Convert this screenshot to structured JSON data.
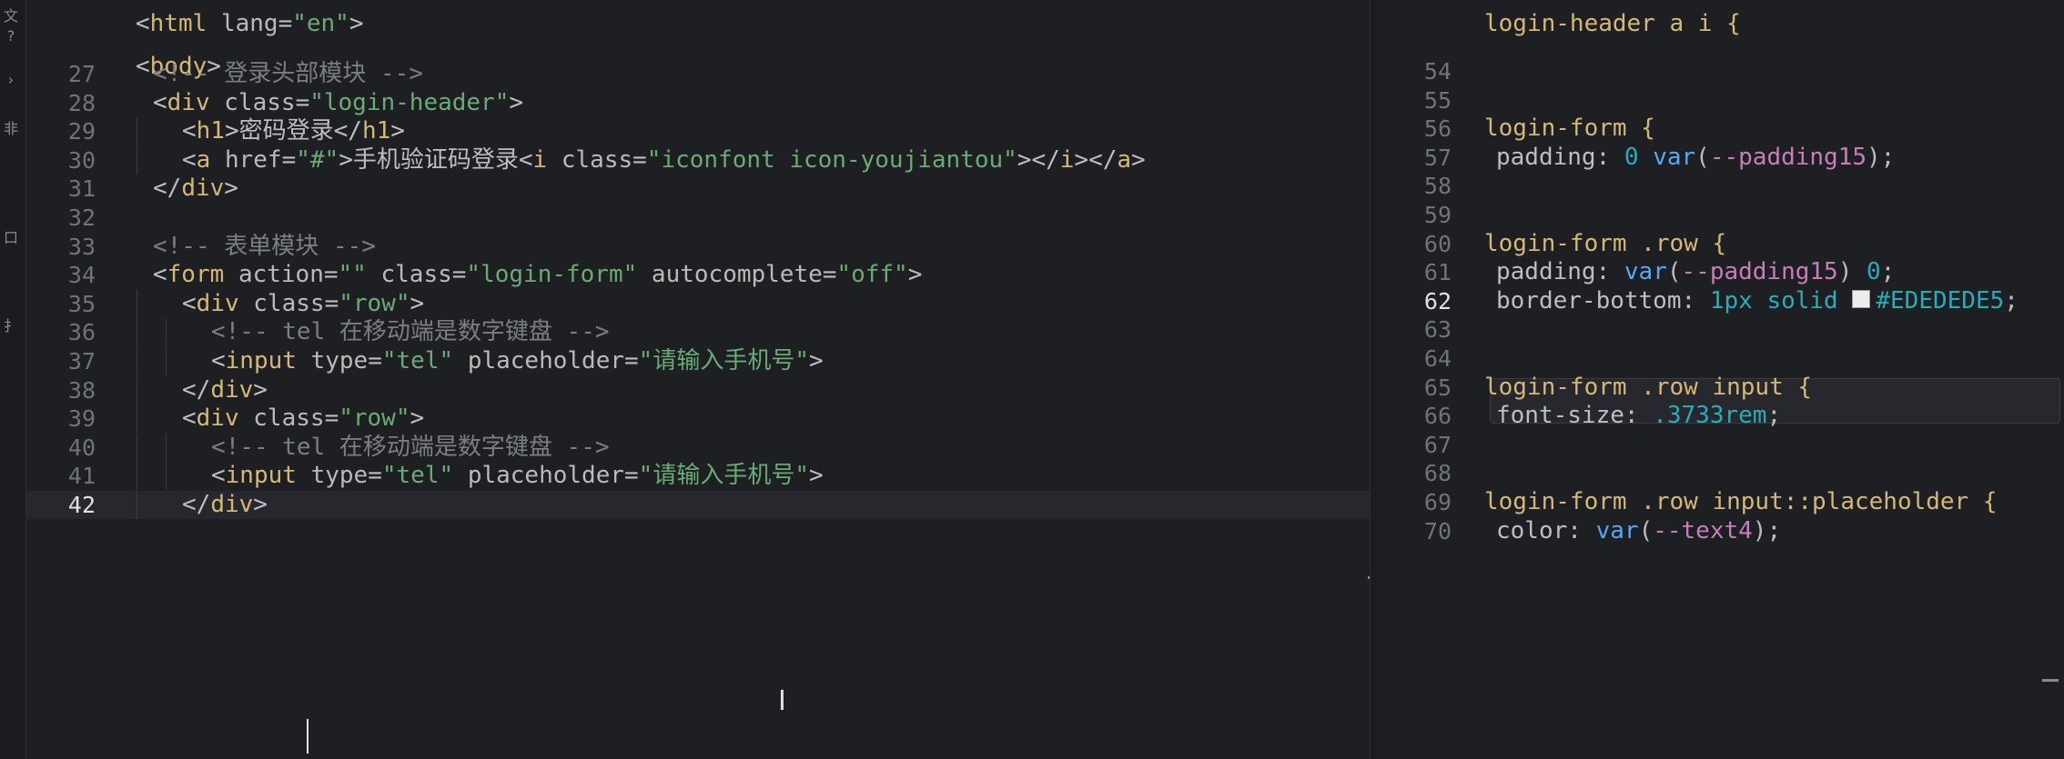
{
  "activity_bar": {
    "icons": [
      {
        "name": "explorer-icon",
        "glyph": "文"
      },
      {
        "name": "search-icon",
        "glyph": "?"
      },
      {
        "name": "arrow-right-icon",
        "glyph": "›"
      },
      {
        "name": "source-control-icon",
        "glyph": "⾮"
      },
      {
        "name": "debug-icon",
        "glyph": "⼝"
      },
      {
        "name": "extensions-icon",
        "glyph": "⺘"
      }
    ]
  },
  "left_editor": {
    "header_lines": [
      {
        "text": "<html lang=\"en\">"
      },
      {
        "text": "<body>"
      }
    ],
    "lines": [
      {
        "number": "27",
        "text": "<!-- 登录头部模块 -->"
      },
      {
        "number": "28",
        "text": "<div class=\"login-header\">"
      },
      {
        "number": "29",
        "text": "<h1>密码登录</h1>"
      },
      {
        "number": "30",
        "text": "<a href=\"#\">手机验证码登录<i class=\"iconfont icon-youjiantou\"></i></a>"
      },
      {
        "number": "31",
        "text": "</div>"
      },
      {
        "number": "32",
        "text": ""
      },
      {
        "number": "33",
        "text": "<!-- 表单模块 -->"
      },
      {
        "number": "34",
        "text": "<form action=\"\" class=\"login-form\" autocomplete=\"off\">"
      },
      {
        "number": "35",
        "text": "<div class=\"row\">"
      },
      {
        "number": "36",
        "text": "<!-- tel 在移动端是数字键盘 -->"
      },
      {
        "number": "37",
        "text": "<input type=\"tel\" placeholder=\"请输入手机号\">"
      },
      {
        "number": "38",
        "text": "</div>"
      },
      {
        "number": "39",
        "text": "<div class=\"row\">"
      },
      {
        "number": "40",
        "text": "<!-- tel 在移动端是数字键盘 -->"
      },
      {
        "number": "41",
        "text": "<input type=\"tel\" placeholder=\"请输入手机号\">"
      },
      {
        "number": "42",
        "text": "</div>"
      }
    ]
  },
  "right_editor": {
    "header_line": "login-header a i {",
    "lines": [
      {
        "number": "54",
        "text": ""
      },
      {
        "number": "55",
        "text": ""
      },
      {
        "number": "56",
        "text": "login-form {"
      },
      {
        "number": "57",
        "text": "padding: 0 var(--padding15);"
      },
      {
        "number": "58",
        "text": ""
      },
      {
        "number": "59",
        "text": ""
      },
      {
        "number": "60",
        "text": "login-form .row {"
      },
      {
        "number": "61",
        "text": "padding: var(--padding15) 0;"
      },
      {
        "number": "62",
        "text": "border-bottom: 1px solid #EDEDEDE5;"
      },
      {
        "number": "63",
        "text": ""
      },
      {
        "number": "64",
        "text": ""
      },
      {
        "number": "65",
        "text": "login-form .row input {"
      },
      {
        "number": "66",
        "text": "font-size: .3733rem;"
      },
      {
        "number": "67",
        "text": ""
      },
      {
        "number": "68",
        "text": ""
      },
      {
        "number": "69",
        "text": "login-form .row input::placeholder {"
      },
      {
        "number": "70",
        "text": "color: var(--text4);"
      }
    ]
  },
  "colors": {
    "background": "#1e1f22",
    "current_line": "#26282e",
    "tag": "#d5b778",
    "string": "#6aab73",
    "comment": "#7a7e85",
    "number": "#2aacb8",
    "function": "#56a8f5",
    "variable": "#c77dbb",
    "swatch": "#EDEDEDE5"
  },
  "current_line": {
    "left": "42",
    "right": "62"
  }
}
